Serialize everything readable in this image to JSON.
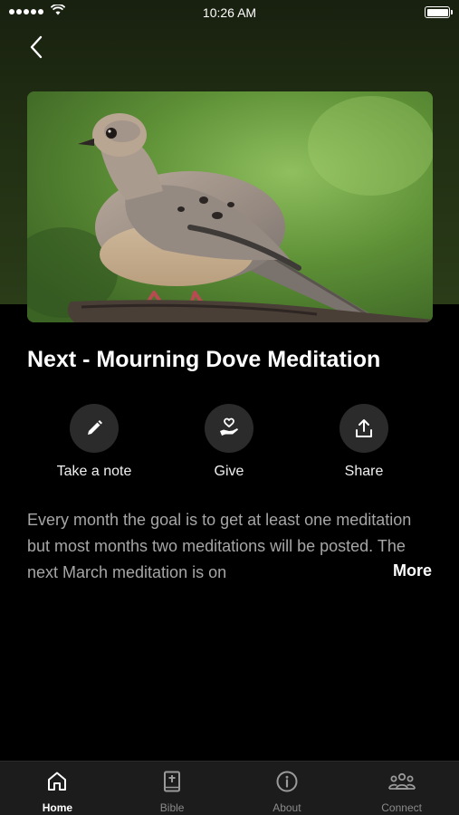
{
  "status_bar": {
    "time": "10:26 AM"
  },
  "hero": {
    "image": "mourning-dove-photo"
  },
  "title": "Next - Mourning Dove Meditation",
  "actions": [
    {
      "label": "Take a note",
      "icon": "pencil-icon"
    },
    {
      "label": "Give",
      "icon": "hand-heart-icon"
    },
    {
      "label": "Share",
      "icon": "share-icon"
    }
  ],
  "description": "Every month the goal is to get at least one meditation but most months two meditations will be posted. The next March meditation is on",
  "more_label": "More",
  "tabs": [
    {
      "label": "Home",
      "icon": "home-icon",
      "active": true
    },
    {
      "label": "Bible",
      "icon": "bible-icon",
      "active": false
    },
    {
      "label": "About",
      "icon": "info-icon",
      "active": false
    },
    {
      "label": "Connect",
      "icon": "people-icon",
      "active": false
    }
  ],
  "colors": {
    "background": "#000000",
    "header_green": "#2a3c18",
    "tab_bar": "#1c1c1c",
    "button_circle": "#2b2b2b"
  }
}
